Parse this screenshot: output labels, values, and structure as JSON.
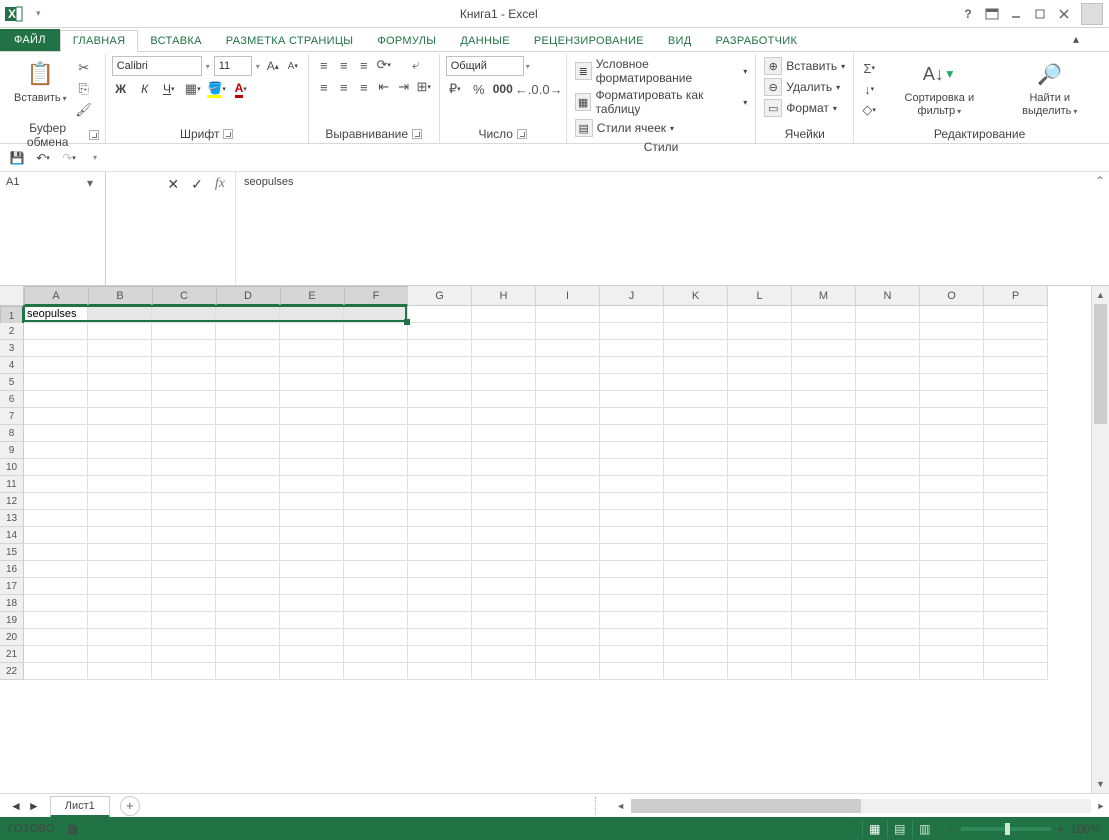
{
  "title": "Книга1 - Excel",
  "tabs": {
    "file": "ФАЙЛ",
    "items": [
      "ГЛАВНАЯ",
      "ВСТАВКА",
      "РАЗМЕТКА СТРАНИЦЫ",
      "ФОРМУЛЫ",
      "ДАННЫЕ",
      "РЕЦЕНЗИРОВАНИЕ",
      "ВИД",
      "РАЗРАБОТЧИК"
    ],
    "active": 0
  },
  "ribbon": {
    "clipboard": {
      "paste": "Вставить",
      "label": "Буфер обмена"
    },
    "font": {
      "name": "Calibri",
      "size": "11",
      "label": "Шрифт"
    },
    "align": {
      "label": "Выравнивание"
    },
    "number": {
      "format": "Общий",
      "label": "Число"
    },
    "styles": {
      "cond": "Условное форматирование",
      "table": "Форматировать как таблицу",
      "cell": "Стили ячеек",
      "label": "Стили"
    },
    "cells": {
      "ins": "Вставить",
      "del": "Удалить",
      "fmt": "Формат",
      "label": "Ячейки"
    },
    "editing": {
      "sort": "Сортировка и фильтр",
      "find": "Найти и выделить",
      "label": "Редактирование"
    }
  },
  "namebox": "A1",
  "formula": "seopulses",
  "columns": [
    "A",
    "B",
    "C",
    "D",
    "E",
    "F",
    "G",
    "H",
    "I",
    "J",
    "K",
    "L",
    "M",
    "N",
    "O",
    "P"
  ],
  "selectedCols": 6,
  "rowCount": 22,
  "cellA1": "seopulses",
  "sheet": "Лист1",
  "status": "ГОТОВО",
  "zoom": "100%"
}
